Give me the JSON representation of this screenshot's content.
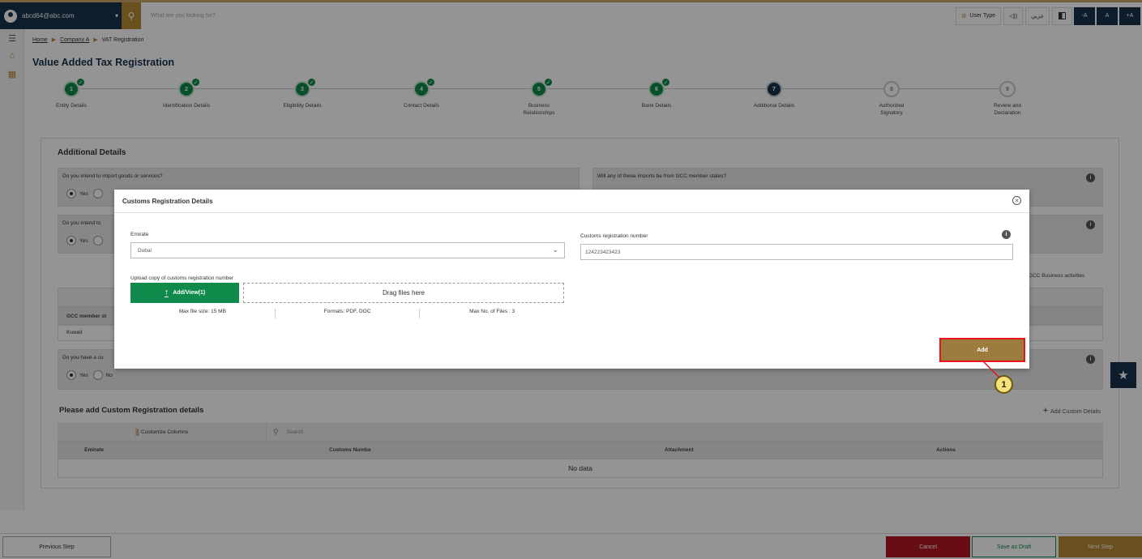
{
  "topbar": {
    "user_email": "abcd64@abc.com",
    "search_placeholder": "What are you looking for?",
    "user_type": "User Type",
    "audio_label": "◁))",
    "language": "عربي",
    "font_decrease": "-A",
    "font_normal": "A",
    "font_increase": "+A"
  },
  "breadcrumb": {
    "home": "Home",
    "company": "Company A",
    "current": "VAT Registration"
  },
  "page_title": "Value Added Tax Registration",
  "steps": [
    {
      "num": "1",
      "label": "Entity Details",
      "status": "done"
    },
    {
      "num": "2",
      "label": "Identification Details",
      "status": "done"
    },
    {
      "num": "3",
      "label": "Eligibility Details",
      "status": "done"
    },
    {
      "num": "4",
      "label": "Contact Details",
      "status": "done"
    },
    {
      "num": "5",
      "label": "Business Relationships",
      "status": "done"
    },
    {
      "num": "6",
      "label": "Bank Details",
      "status": "done"
    },
    {
      "num": "7",
      "label": "Additional Details",
      "status": "current"
    },
    {
      "num": "8",
      "label": "Authorized Signatory",
      "status": "todo"
    },
    {
      "num": "9",
      "label": "Review and Declaration",
      "status": "todo"
    }
  ],
  "card": {
    "title": "Additional Details",
    "q1": "Do you intend to import goods or services?",
    "q2": "Will any of these imports be from GCC member states?",
    "q3": "Do you intend to",
    "q4": "Do you have a cu",
    "yes": "Yes",
    "no": "No",
    "gcc_activities": "GCC Business activities",
    "gcc_member_header": "GCC member st",
    "gcc_value": "Kuwait",
    "custom_reg_title": "Please add Custom Registration details",
    "add_custom": "Add Custom Details",
    "customize_columns": "Customize Columns",
    "search": "Search",
    "columns": [
      "Emirate",
      "Customs Numbe",
      "Attachment",
      "Actions"
    ],
    "no_data": "No data"
  },
  "footer": {
    "previous": "Previous Step",
    "cancel": "Cancel",
    "save_draft": "Save as Draft",
    "next": "Next Step"
  },
  "modal": {
    "title": "Customs Registration Details",
    "emirate_label": "Emirate",
    "emirate_value": "Dubai",
    "reg_number_label": "Customs registration number",
    "reg_number_value": "124223423423",
    "upload_label": "Upload copy of customs registration number",
    "upload_button": "Add/View(1)",
    "drop_text": "Drag files here",
    "max_size": "Max file size: 15 MB",
    "formats": "Formats: PDF, DOC",
    "max_files": "Max No. of Files : 3",
    "add_button": "Add"
  },
  "callout": {
    "number": "1"
  },
  "colors": {
    "navy": "#17324d",
    "gold": "#b68a35",
    "green": "#0f8a4a",
    "red": "#b1151f",
    "highlight": "#e8121c"
  }
}
